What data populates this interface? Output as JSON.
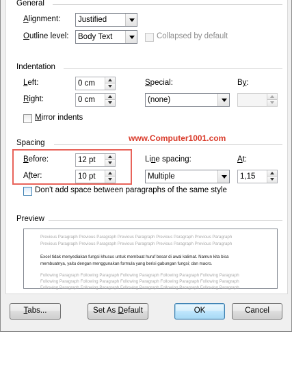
{
  "general": {
    "title": "General",
    "alignment_label": "Alignment:",
    "alignment_value": "Justified",
    "outline_label": "Outline level:",
    "outline_value": "Body Text",
    "collapsed_label": "Collapsed by default"
  },
  "indentation": {
    "title": "Indentation",
    "left_label": "Left:",
    "left_value": "0 cm",
    "right_label": "Right:",
    "right_value": "0 cm",
    "special_label": "Special:",
    "special_value": "(none)",
    "by_label": "By:",
    "by_value": "",
    "mirror_label": "Mirror indents"
  },
  "watermark": "www.Computer1001.com",
  "spacing": {
    "title": "Spacing",
    "before_label": "Before:",
    "before_value": "12 pt",
    "after_label": "After:",
    "after_value": "10 pt",
    "line_spacing_label": "Line spacing:",
    "line_spacing_value": "Multiple",
    "at_label": "At:",
    "at_value": "1,15",
    "dont_add_label": "Don't add space between paragraphs of the same style"
  },
  "preview": {
    "title": "Preview",
    "prev_lines": [
      "Previous Paragraph Previous Paragraph Previous Paragraph Previous Paragraph Previous Paragraph",
      "Previous Paragraph Previous Paragraph Previous Paragraph Previous Paragraph Previous Paragraph"
    ],
    "current_lines": [
      "Excel tidak menyediakan fungsi khusus untuk membuat huruf besar di awal kalimat. Namun kita bisa",
      "membuatnya, yaitu dengan menggunakan formula yang berisi gabungan fungsi; dan macro."
    ],
    "next_lines": [
      "Following Paragraph Following Paragraph Following Paragraph Following Paragraph Following Paragraph",
      "Following Paragraph Following Paragraph Following Paragraph Following Paragraph Following Paragraph",
      "Following Paragraph Following Paragraph Following Paragraph Following Paragraph Following Paragraph"
    ]
  },
  "buttons": {
    "tabs": "Tabs...",
    "set_default": "Set As Default",
    "ok": "OK",
    "cancel": "Cancel"
  },
  "colors": {
    "highlight": "#e8635a",
    "watermark": "#d93b2b",
    "default_button_border": "#3c7fb1"
  }
}
